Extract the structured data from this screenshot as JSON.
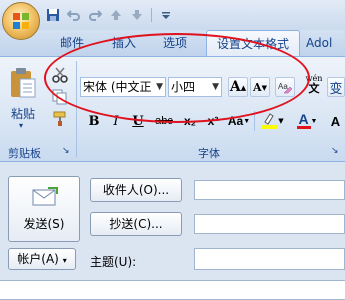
{
  "qat": {
    "icons": [
      "save-icon",
      "undo-icon",
      "redo-icon",
      "up-arrow-icon",
      "down-arrow-icon",
      "customize-qat-icon"
    ]
  },
  "tabs": [
    {
      "label": "邮件",
      "active": false
    },
    {
      "label": "插入",
      "active": false
    },
    {
      "label": "选项",
      "active": false
    },
    {
      "label": "设置文本格式",
      "active": true
    },
    {
      "label": "Adol",
      "active": false
    }
  ],
  "clipboard": {
    "paste_label": "粘贴",
    "group_label": "剪贴板"
  },
  "font": {
    "group_label": "字体",
    "font_name": "宋体 (中文正",
    "font_size": "小四",
    "grow_label": "A",
    "shrink_label": "A",
    "clear_label": "A",
    "bold": "B",
    "italic": "I",
    "underline": "U",
    "strike": "abc",
    "subscript": "x₂",
    "superscript": "x²",
    "change_case": "Aa",
    "font_color": "A",
    "wen": "wén",
    "bian": "变"
  },
  "form": {
    "send_label": "发送(S)",
    "to_label": "收件人(O)...",
    "cc_label": "抄送(C)...",
    "account_label": "帐户(A)",
    "subject_label": "主题(U):"
  },
  "colors": {
    "accent": "#15428b",
    "highlight": "#ffff00",
    "font_color": "#e0121e",
    "annotation": "#e0121e"
  }
}
